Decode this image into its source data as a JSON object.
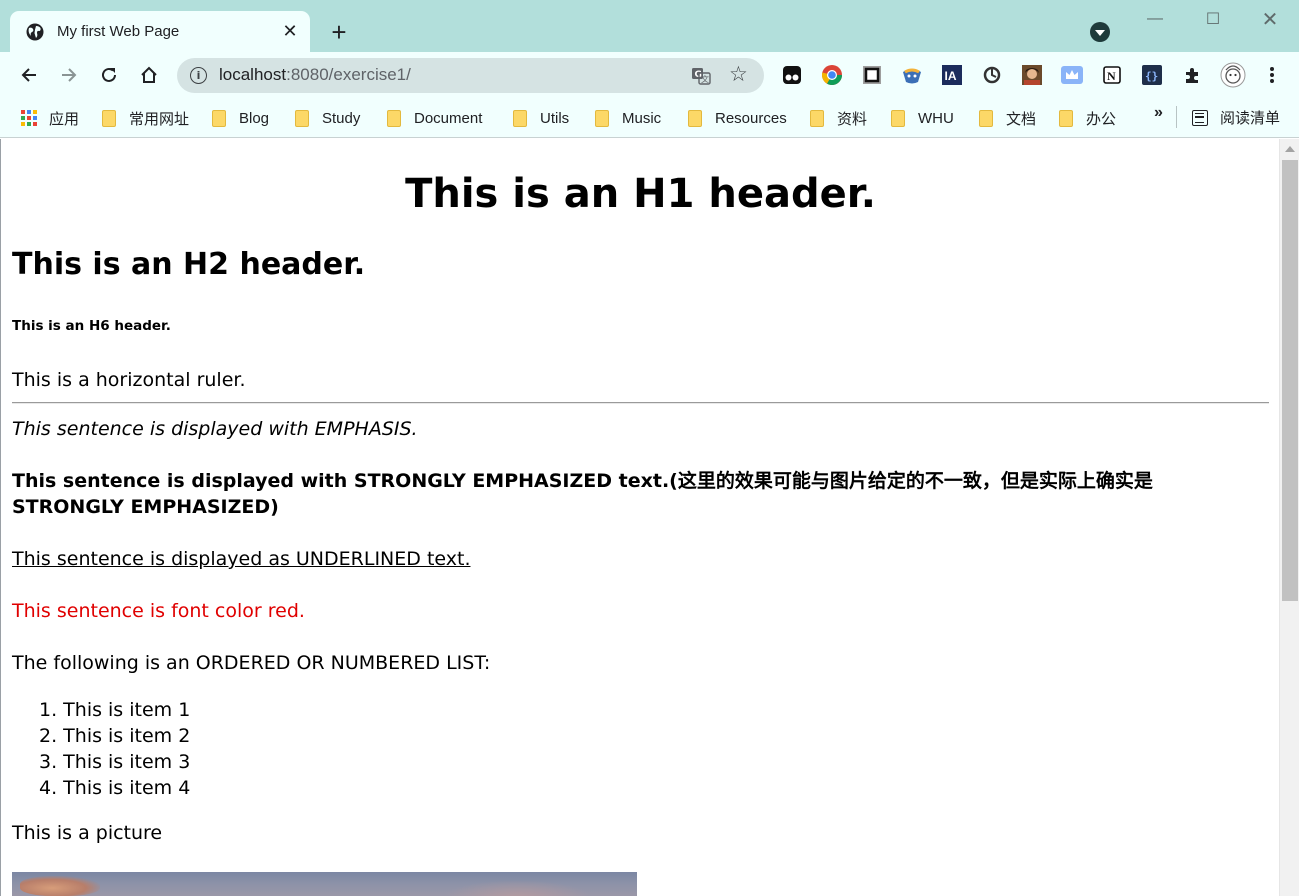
{
  "browser": {
    "tab_title": "My first Web Page",
    "new_tab_label": "+",
    "window_controls": {
      "minimize": "—",
      "maximize": "☐",
      "close": "✕"
    }
  },
  "toolbar": {
    "url_host": "localhost",
    "url_path": ":8080/exercise1/",
    "icons": [
      "back-icon",
      "forward-icon",
      "reload-icon",
      "home-icon",
      "site-info-icon",
      "translate-icon",
      "star-icon",
      "extensions-icon",
      "menu-icon"
    ]
  },
  "bookmarks": {
    "apps_label": "应用",
    "items": [
      {
        "label": "常用网址"
      },
      {
        "label": "Blog"
      },
      {
        "label": "Study"
      },
      {
        "label": "Document"
      },
      {
        "label": "Utils"
      },
      {
        "label": "Music"
      },
      {
        "label": "Resources"
      },
      {
        "label": "资料"
      },
      {
        "label": "WHU"
      },
      {
        "label": "文档"
      },
      {
        "label": "办公"
      }
    ],
    "more_label": "»",
    "reading_list_label": "阅读清单"
  },
  "page": {
    "h1": "This is an H1 header.",
    "h2": "This is an H2 header.",
    "h6": "This is an H6 header.",
    "ruler_text": "This is a horizontal ruler.",
    "emphasis_text": "This sentence is displayed with EMPHASIS.",
    "strong_text": "This sentence is displayed with STRONGLY EMPHASIZED text.(这里的效果可能与图片给定的不一致，但是实际上确实是STRONGLY EMPHASIZED)",
    "underline_text": "This sentence is displayed as UNDERLINED text.",
    "red_text": "This sentence is font color red.",
    "list_intro": "The following is an ORDERED OR NUMBERED LIST:",
    "list_items": [
      "1. This is item 1",
      "2. This is item 2",
      "3. This is item 3",
      "4. This is item 4"
    ],
    "picture_caption": "This is a picture"
  },
  "colors": {
    "frame": "#b2dfdb",
    "toolbar": "#f1fffe",
    "omnibox": "#d5e3e3",
    "red_text": "#e00000"
  }
}
